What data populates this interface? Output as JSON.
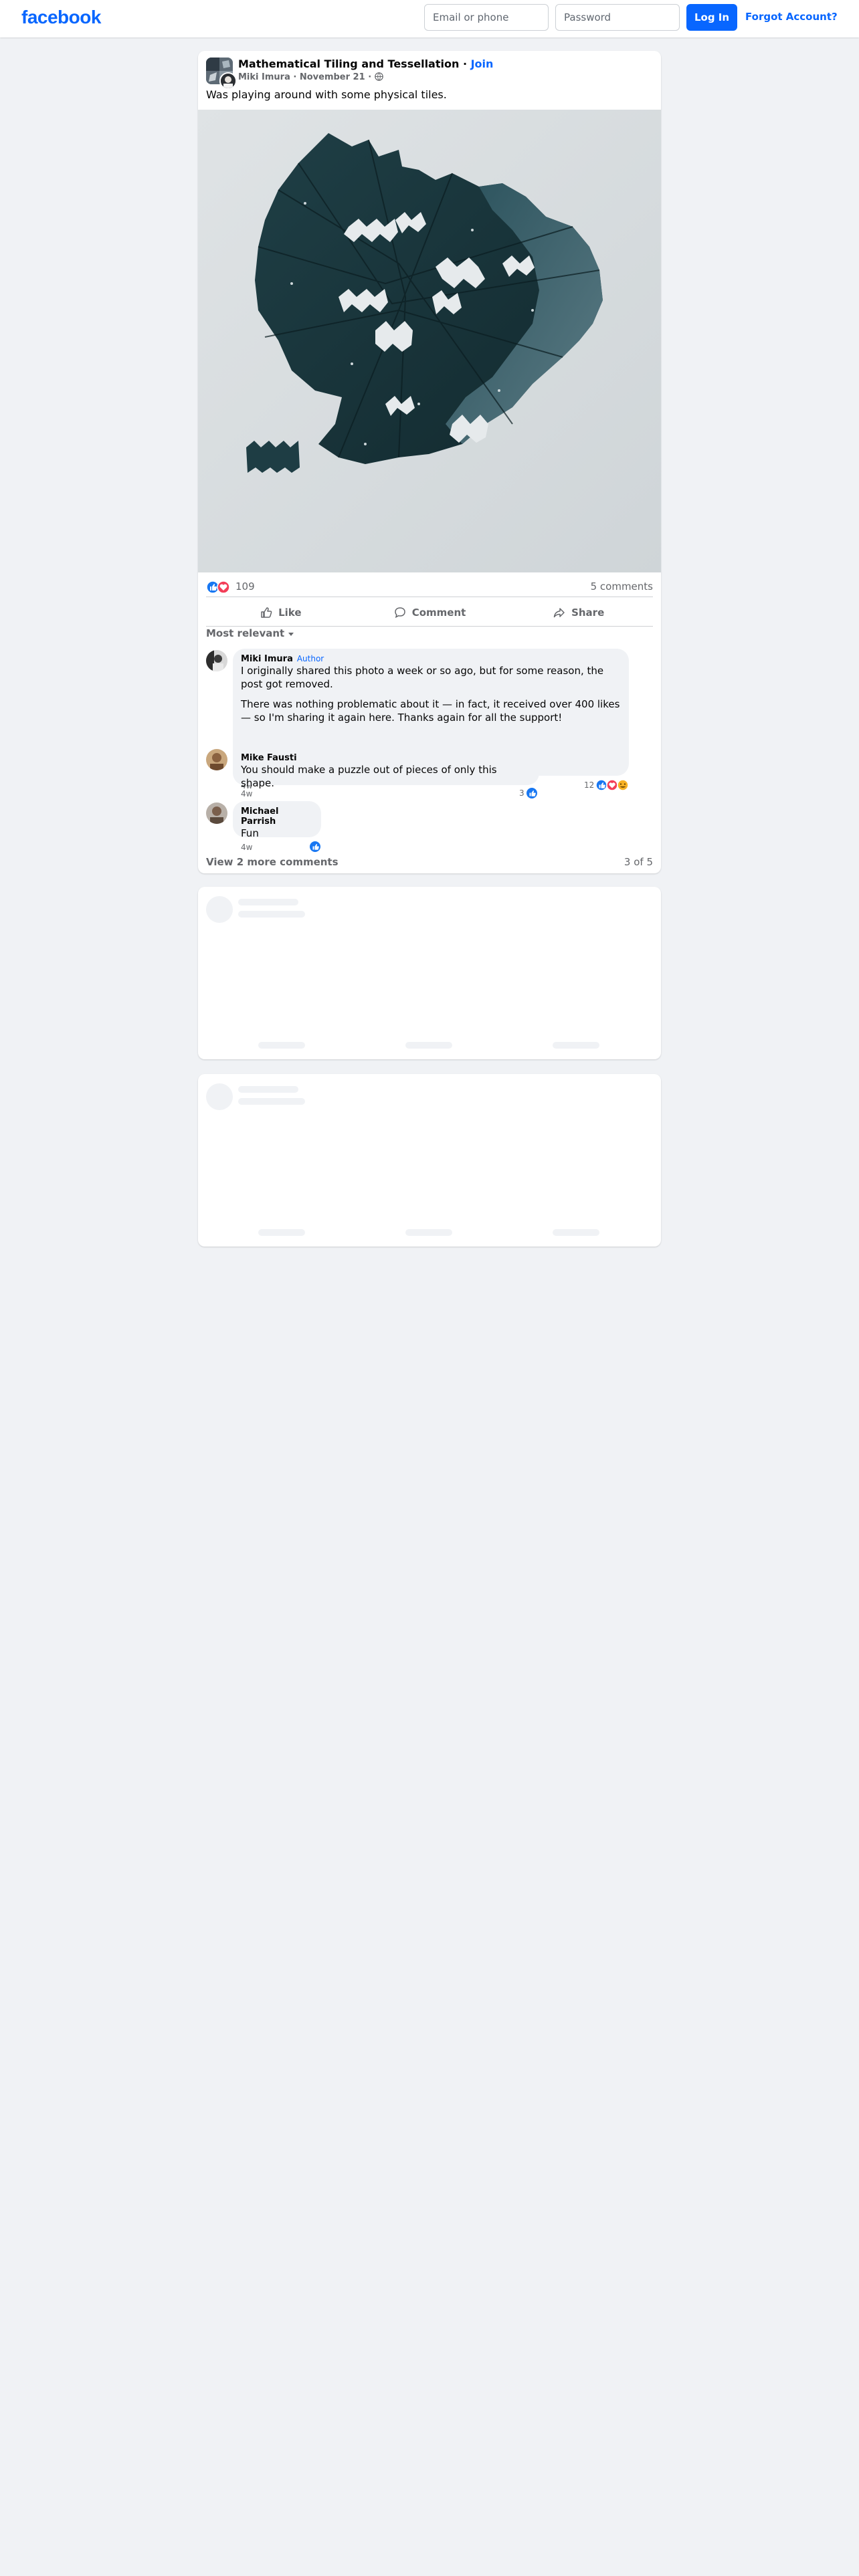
{
  "header": {
    "logo": "facebook",
    "email_placeholder": "Email or phone",
    "password_placeholder": "Password",
    "login_label": "Log In",
    "forgot_label": "Forgot Account?"
  },
  "post": {
    "group_name": "Mathematical Tiling and Tessellation",
    "join_label": "Join",
    "author": "Miki Imura",
    "date": "November 21",
    "text": "Was playing around with some physical tiles.",
    "image_icon": "photo-of-tiles",
    "reaction_count": "109",
    "comments_count": "5 comments",
    "actions": {
      "like": "Like",
      "comment": "Comment",
      "share": "Share"
    },
    "sort_label": "Most relevant",
    "view_more": "View 2 more comments",
    "page_count": "3 of 5"
  },
  "comments": [
    {
      "author": "Miki Imura",
      "badge": "Author",
      "paragraphs": [
        "I originally shared this photo a week or so ago, but for some reason, the post got removed.",
        "There was nothing problematic about it — in fact, it received over 400 likes — so I'm sharing it again here. Thanks again for all the support!"
      ],
      "time": "4w",
      "reaction_count": "12"
    },
    {
      "author": "Mike Fausti",
      "text": "You should make a puzzle out of pieces of only this shape.",
      "time": "4w",
      "reaction_count": "3"
    },
    {
      "author": "Michael Parrish",
      "text": "Fun",
      "time": "4w",
      "reaction_count": ""
    }
  ],
  "colors": {
    "brand": "#0866ff",
    "like": "#1877f2",
    "love": "#f33e58",
    "care": "#f7b125",
    "page_bg": "#f0f2f5"
  }
}
